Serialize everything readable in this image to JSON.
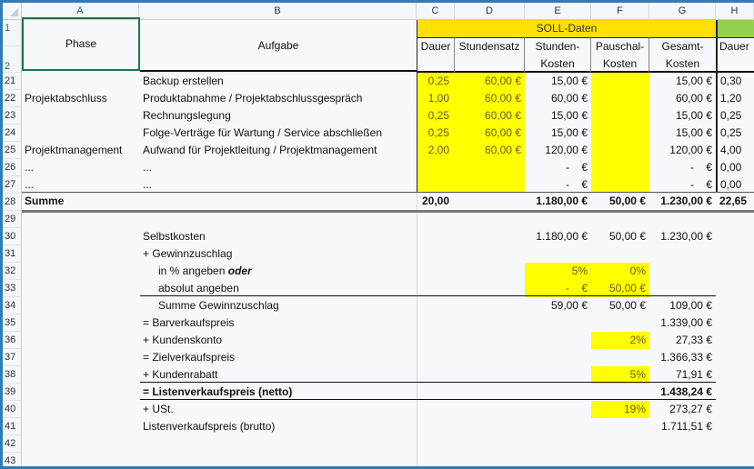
{
  "columns": [
    "A",
    "B",
    "C",
    "D",
    "E",
    "F",
    "G",
    "H"
  ],
  "header": {
    "soll_title": "SOLL-Daten",
    "phase": "Phase",
    "aufgabe": "Aufgabe",
    "dauer": "Dauer",
    "stundensatz": "Stundensatz",
    "stundenkosten_1": "Stunden-",
    "stundenkosten_2": "Kosten",
    "pauschal_1": "Pauschal-",
    "pauschal_2": "Kosten",
    "gesamt_1": "Gesamt-",
    "gesamt_2": "Kosten",
    "dauer_h": "Dauer"
  },
  "row_numbers": [
    "1",
    "2",
    "21",
    "22",
    "23",
    "24",
    "25",
    "26",
    "27",
    "28",
    "29",
    "30",
    "31",
    "32",
    "33",
    "34",
    "35",
    "36",
    "37",
    "38",
    "39",
    "40",
    "41",
    "42",
    "43"
  ],
  "task_rows": [
    {
      "row": "21",
      "phase": "",
      "aufgabe": "Backup erstellen",
      "dauer": "0,25",
      "satz": "60,00 €",
      "stunden": "15,00 €",
      "pauschal": "",
      "gesamt": "15,00 €",
      "h": "0,30"
    },
    {
      "row": "22",
      "phase": "Projektabschluss",
      "aufgabe": "Produktabnahme / Projektabschlussgespräch",
      "dauer": "1,00",
      "satz": "60,00 €",
      "stunden": "60,00 €",
      "pauschal": "",
      "gesamt": "60,00 €",
      "h": "1,20"
    },
    {
      "row": "23",
      "phase": "",
      "aufgabe": "Rechnungslegung",
      "dauer": "0,25",
      "satz": "60,00 €",
      "stunden": "15,00 €",
      "pauschal": "",
      "gesamt": "15,00 €",
      "h": "0,25"
    },
    {
      "row": "24",
      "phase": "",
      "aufgabe": "Folge-Verträge für Wartung / Service abschließen",
      "dauer": "0,25",
      "satz": "60,00 €",
      "stunden": "15,00 €",
      "pauschal": "",
      "gesamt": "15,00 €",
      "h": "0,25"
    },
    {
      "row": "25",
      "phase": "Projektmanagement",
      "aufgabe": "Aufwand für Projektleitung / Projektmanagement",
      "dauer": "2,00",
      "satz": "60,00 €",
      "stunden": "120,00 €",
      "pauschal": "",
      "gesamt": "120,00 €",
      "h": "4,00"
    },
    {
      "row": "26",
      "phase": "...",
      "aufgabe": "...",
      "dauer": "",
      "satz": "",
      "stunden": "-    €",
      "pauschal": "",
      "gesamt": "-    €",
      "h": "0,00"
    },
    {
      "row": "27",
      "phase": "...",
      "aufgabe": "...",
      "dauer": "",
      "satz": "",
      "stunden": "-    €",
      "pauschal": "",
      "gesamt": "-    €",
      "h": "0,00"
    }
  ],
  "summe": {
    "label": "Summe",
    "dauer": "20,00",
    "stunden": "1.180,00 €",
    "pauschal": "50,00 €",
    "gesamt": "1.230,00 €",
    "h": "22,65"
  },
  "calc": {
    "selbstkosten": {
      "label": "Selbstkosten",
      "e": "1.180,00 €",
      "f": "50,00 €",
      "g": "1.230,00 €"
    },
    "gewinnzuschlag": {
      "label": "+ Gewinnzuschlag"
    },
    "in_prozent": {
      "label_pre": "in % angeben ",
      "label_em": "oder",
      "e": "5%",
      "f": "0%"
    },
    "absolut": {
      "label": "absolut angeben",
      "e": "-    €",
      "f": "50,00 €"
    },
    "summe_gewinn": {
      "label": "Summe Gewinnzuschlag",
      "e": "59,00 €",
      "f": "50,00 €",
      "g": "109,00 €"
    },
    "barverkaufspreis": {
      "label": "= Barverkaufspreis",
      "g": "1.339,00 €"
    },
    "kundenskonto": {
      "label": "+ Kundenskonto",
      "f": "2%",
      "g": "27,33 €"
    },
    "zielverkaufspreis": {
      "label": "= Zielverkaufspreis",
      "g": "1.366,33 €"
    },
    "kundenrabatt": {
      "label": "+ Kundenrabatt",
      "f": "5%",
      "g": "71,91 €"
    },
    "listen_netto": {
      "label": "= Listenverkaufspreis (netto)",
      "g": "1.438,24 €"
    },
    "ust": {
      "label": "+ USt.",
      "f": "19%",
      "g": "273,27 €"
    },
    "listen_brutto": {
      "label": "Listenverkaufspreis (brutto)",
      "g": "1.711,51 €"
    }
  },
  "colors": {
    "soll_header": "#ffe000",
    "input_yellow": "#ffff00",
    "ist_header": "#92d050",
    "selection": "#217346",
    "frame": "#2e7cb8"
  }
}
